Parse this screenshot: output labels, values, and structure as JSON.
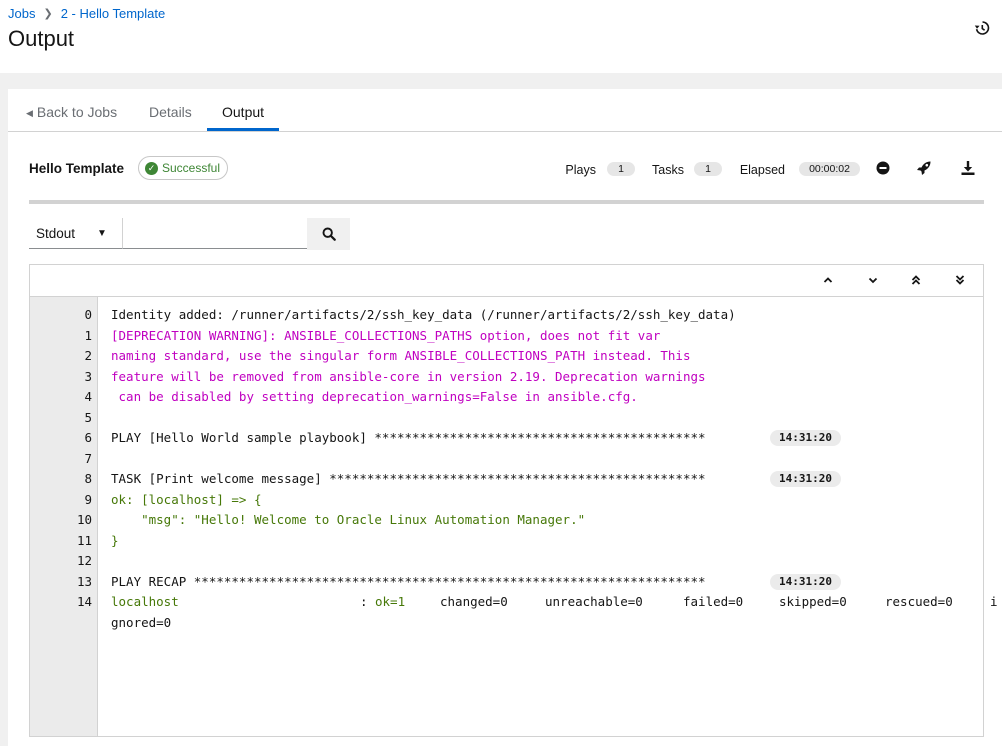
{
  "breadcrumb": {
    "root": "Jobs",
    "current": "2 - Hello Template"
  },
  "page": {
    "title": "Output"
  },
  "tabs": {
    "back": "Back to Jobs",
    "details": "Details",
    "output": "Output"
  },
  "job": {
    "name": "Hello Template",
    "status": "Successful",
    "plays_label": "Plays",
    "plays_count": "1",
    "tasks_label": "Tasks",
    "tasks_count": "1",
    "elapsed_label": "Elapsed",
    "elapsed_value": "00:00:02"
  },
  "search": {
    "field": "Stdout",
    "value": ""
  },
  "icons": {
    "history": "history-icon",
    "cancel": "minus-circle-icon",
    "relaunch": "rocket-icon",
    "download": "download-icon",
    "search": "search-icon",
    "nav": [
      "angle-up-icon",
      "angle-down-icon",
      "angle-double-up-icon",
      "angle-double-down-icon"
    ]
  },
  "colors": {
    "link": "#0066cc",
    "success": "#3e8635",
    "warning": "#c000c0",
    "ok": "#467808"
  },
  "output": {
    "lines": [
      {
        "n": "0",
        "text": "Identity added: /runner/artifacts/2/ssh_key_data (/runner/artifacts/2/ssh_key_data)",
        "kind": "plain",
        "ts": ""
      },
      {
        "n": "1",
        "text": "[DEPRECATION WARNING]: ANSIBLE_COLLECTIONS_PATHS option, does not fit var",
        "kind": "warn",
        "ts": ""
      },
      {
        "n": "2",
        "text": "naming standard, use the singular form ANSIBLE_COLLECTIONS_PATH instead. This",
        "kind": "warn",
        "ts": ""
      },
      {
        "n": "3",
        "text": "feature will be removed from ansible-core in version 2.19. Deprecation warnings",
        "kind": "warn",
        "ts": ""
      },
      {
        "n": "4",
        "text": " can be disabled by setting deprecation_warnings=False in ansible.cfg.",
        "kind": "warn",
        "ts": ""
      },
      {
        "n": "5",
        "text": "",
        "kind": "plain",
        "ts": ""
      },
      {
        "n": "6",
        "text": "PLAY [Hello World sample playbook] ********************************************",
        "kind": "plain",
        "ts": "14:31:20"
      },
      {
        "n": "7",
        "text": "",
        "kind": "plain",
        "ts": ""
      },
      {
        "n": "8",
        "text": "TASK [Print welcome message] **************************************************",
        "kind": "plain",
        "ts": "14:31:20"
      },
      {
        "n": "9",
        "text": "ok: [localhost] => {",
        "kind": "ok",
        "ts": ""
      },
      {
        "n": "10",
        "text": "    \"msg\": \"Hello! Welcome to Oracle Linux Automation Manager.\"",
        "kind": "ok",
        "ts": ""
      },
      {
        "n": "11",
        "text": "}",
        "kind": "ok",
        "ts": ""
      },
      {
        "n": "12",
        "text": "",
        "kind": "plain",
        "ts": ""
      },
      {
        "n": "13",
        "text": "PLAY RECAP ********************************************************************",
        "kind": "plain",
        "ts": "14:31:20"
      }
    ],
    "recap": {
      "n": "14",
      "host": "localhost",
      "colon": ":",
      "ok": "ok=1",
      "changed": "changed=0",
      "unreachable": "unreachable=0",
      "failed": "failed=0",
      "skipped": "skipped=0",
      "rescued": "rescued=0",
      "ignored_a": "i",
      "ignored_b": "gnored=0"
    }
  }
}
